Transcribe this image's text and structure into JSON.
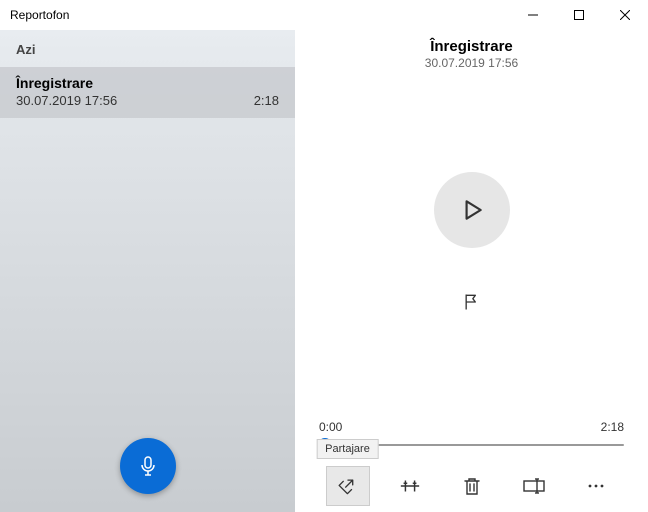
{
  "titlebar": {
    "app_name": "Reportofon"
  },
  "sidebar": {
    "section_label": "Azi",
    "items": [
      {
        "title": "Înregistrare",
        "timestamp": "30.07.2019 17:56",
        "duration": "2:18"
      }
    ]
  },
  "main": {
    "title": "Înregistrare",
    "timestamp": "30.07.2019 17:56",
    "timeline": {
      "current": "0:00",
      "total": "2:18"
    },
    "tooltip_share": "Partajare"
  }
}
